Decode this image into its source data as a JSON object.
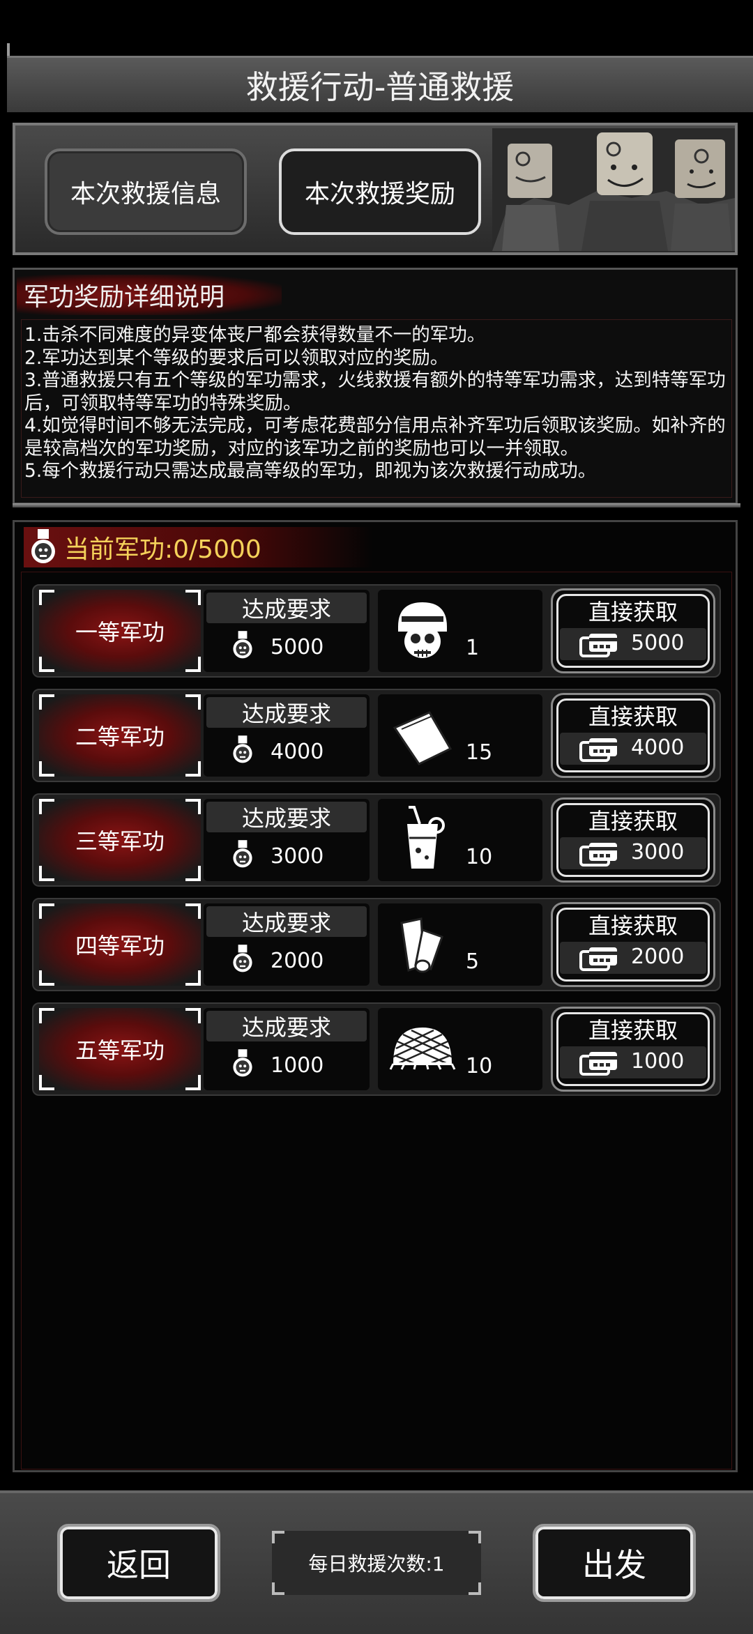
{
  "title": "救援行动-普通救援",
  "tabs": {
    "info_label": "本次救援信息",
    "reward_label": "本次救援奖励"
  },
  "description": {
    "heading": "军功奖励详细说明",
    "lines": [
      "1.击杀不同难度的异变体丧尸都会获得数量不一的军功。",
      "2.军功达到某个等级的要求后可以领取对应的奖励。",
      "3.普通救援只有五个等级的军功需求，火线救援有额外的特等军功需求，达到特等军功后，可领取特等军功的特殊奖励。",
      "4.如觉得时间不够无法完成，可考虑花费部分信用点补齐军功后领取该奖励。如补齐的是较高档次的军功奖励，对应的该军功之前的奖励也可以一并领取。",
      "5.每个救援行动只需达成最高等级的军功，即视为该次救援行动成功。"
    ]
  },
  "current_merit": "当前军功:0/5000",
  "rows": [
    {
      "rank": "一等军功",
      "req_label": "达成要求",
      "req_value": "5000",
      "item_icon": "helmet-skull-icon",
      "item_qty": "1",
      "buy_label": "直接获取",
      "buy_price": "5000"
    },
    {
      "rank": "二等军功",
      "req_label": "达成要求",
      "req_value": "4000",
      "item_icon": "bandage-cloth-icon",
      "item_qty": "15",
      "buy_label": "直接获取",
      "buy_price": "4000"
    },
    {
      "rank": "三等军功",
      "req_label": "达成要求",
      "req_value": "3000",
      "item_icon": "drink-cup-icon",
      "item_qty": "10",
      "buy_label": "直接获取",
      "buy_price": "3000"
    },
    {
      "rank": "四等军功",
      "req_label": "达成要求",
      "req_value": "2000",
      "item_icon": "bandage-roll-icon",
      "item_qty": "5",
      "buy_label": "直接获取",
      "buy_price": "2000"
    },
    {
      "rank": "五等军功",
      "req_label": "达成要求",
      "req_value": "1000",
      "item_icon": "helmet-net-icon",
      "item_qty": "10",
      "buy_label": "直接获取",
      "buy_price": "1000"
    }
  ],
  "bottom": {
    "back_label": "返回",
    "daily_label": "每日救援次数:1",
    "depart_label": "出发"
  }
}
